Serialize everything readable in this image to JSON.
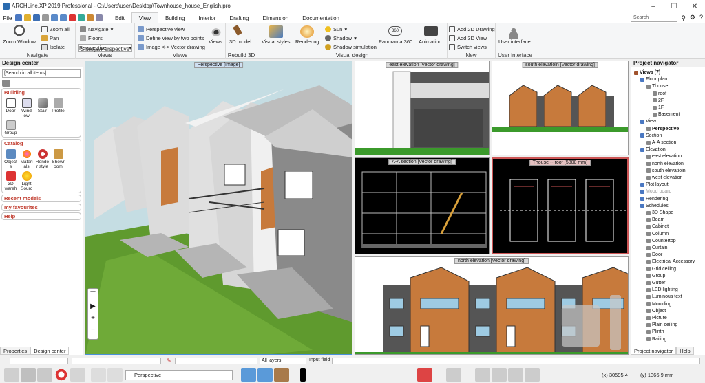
{
  "title_bar": {
    "app": "ARCHLine.XP 2019",
    "edition": "Professional",
    "path": "- C:\\Users\\user\\Desktop\\Townhouse_house_English.pro"
  },
  "menu": {
    "file": "File",
    "tabs": [
      "Edit",
      "View",
      "Building",
      "Interior",
      "Drafting",
      "Dimension",
      "Documentation"
    ],
    "active_tab": "View",
    "search_placeholder": "Search"
  },
  "ribbon": {
    "navigate": {
      "zoom_window": "Zoom Window",
      "zoom_all": "Zoom all",
      "pan": "Pan",
      "isolate": "Isolate",
      "group_label": "Navigate"
    },
    "storeys": {
      "navigate": "Navigate",
      "floors": "Floors",
      "perspective": "Perspective",
      "group_label": "Storeys/Perspective views"
    },
    "views": {
      "perspective_view": "Perspective view",
      "define_view": "Define view by two points",
      "image_vector": "Image <-> Vector drawing",
      "views_btn": "Views",
      "group_label": "Views"
    },
    "rebuild": {
      "model": "3D model",
      "group_label": "Rebuild 3D"
    },
    "visual": {
      "styles": "Visual styles",
      "rendering": "Rendering",
      "sun": "Sun",
      "shadow": "Shadow",
      "shadow_sim": "Shadow simulation",
      "panorama": "Panorama 360",
      "animation": "Animation",
      "group_label": "Visual design"
    },
    "new": {
      "add2d": "Add 2D Drawing",
      "add3d": "Add 3D View",
      "switch": "Switch views",
      "group_label": "New"
    },
    "ui": {
      "label": "User interface",
      "group_label": "User interface"
    }
  },
  "design_center": {
    "title": "Design center",
    "search_placeholder": "[Search in all items]",
    "building": {
      "header": "Building",
      "items": [
        "Door",
        "Wind ow",
        "Stair",
        "Profile",
        "Group"
      ]
    },
    "catalog": {
      "header": "Catalog",
      "items": [
        "Object s",
        "Materi als",
        "Rende r style",
        "Showr oom",
        "3D wareh",
        "Light Sourc"
      ]
    },
    "recent": "Recent models",
    "favourites": "my favourites",
    "help": "Help",
    "tabs": [
      "Properties",
      "Design center"
    ]
  },
  "viewports": {
    "perspective": "Perspective [Image]",
    "east": "east elevation [Vector drawing]",
    "south": "south elevatioin [Vector drawing]",
    "section": "A-A section [Vector drawing]",
    "roof": "Thouse -- roof (5800 mm)",
    "north": "north elevation [Vector drawing]"
  },
  "navigator": {
    "title": "Project navigator",
    "tree": [
      {
        "label": "Views (7)",
        "level": 0,
        "bold": true
      },
      {
        "label": "Floor plan",
        "level": 1
      },
      {
        "label": "Thouse",
        "level": 2
      },
      {
        "label": "roof",
        "level": 3
      },
      {
        "label": "2F",
        "level": 3
      },
      {
        "label": "1F",
        "level": 3
      },
      {
        "label": "Basement",
        "level": 3
      },
      {
        "label": "View",
        "level": 1
      },
      {
        "label": "Perspective",
        "level": 2,
        "bold": true
      },
      {
        "label": "Section",
        "level": 1
      },
      {
        "label": "A-A section",
        "level": 2
      },
      {
        "label": "Elevation",
        "level": 1
      },
      {
        "label": "east elevation",
        "level": 2
      },
      {
        "label": "north elevation",
        "level": 2
      },
      {
        "label": "south elevatioin",
        "level": 2
      },
      {
        "label": "west elevation",
        "level": 2
      },
      {
        "label": "Plot layout",
        "level": 1
      },
      {
        "label": "Mood board",
        "level": 1,
        "dim": true
      },
      {
        "label": "Rendering",
        "level": 1
      },
      {
        "label": "Schedules",
        "level": 1
      },
      {
        "label": "3D Shape",
        "level": 2
      },
      {
        "label": "Beam",
        "level": 2
      },
      {
        "label": "Cabinet",
        "level": 2
      },
      {
        "label": "Column",
        "level": 2
      },
      {
        "label": "Countertop",
        "level": 2
      },
      {
        "label": "Curtain",
        "level": 2
      },
      {
        "label": "Door",
        "level": 2
      },
      {
        "label": "Electrical Accessory",
        "level": 2
      },
      {
        "label": "Grid ceiling",
        "level": 2
      },
      {
        "label": "Group",
        "level": 2
      },
      {
        "label": "Gutter",
        "level": 2
      },
      {
        "label": "LED lighting",
        "level": 2
      },
      {
        "label": "Luminous text",
        "level": 2
      },
      {
        "label": "Moulding",
        "level": 2
      },
      {
        "label": "Object",
        "level": 2
      },
      {
        "label": "Picture",
        "level": 2
      },
      {
        "label": "Plain ceiling",
        "level": 2
      },
      {
        "label": "Plinth",
        "level": 2
      },
      {
        "label": "Railing",
        "level": 2
      }
    ],
    "tabs": [
      "Project navigator",
      "Help"
    ]
  },
  "status": {
    "layers": "All layers",
    "input_field": "Input field",
    "view_select": "Perspective",
    "x": "(x) 30595.4",
    "y": "(y) 1366.9 mm"
  },
  "colors": {
    "accent": "#2b6cb0",
    "header_red": "#c0392b",
    "grass": "#5f9a2e",
    "brick": "#c77a3c"
  }
}
